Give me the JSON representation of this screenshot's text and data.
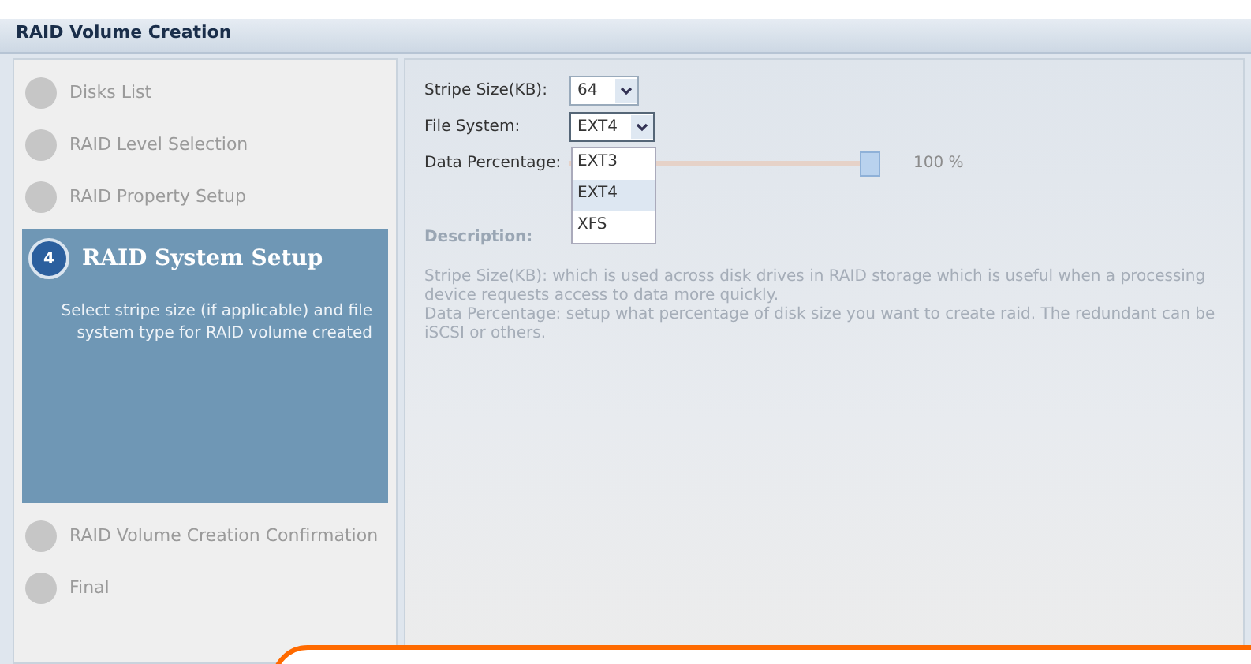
{
  "window": {
    "title": "RAID Volume Creation"
  },
  "steps": [
    {
      "label": "Disks List",
      "selected": false
    },
    {
      "label": "RAID Level Selection",
      "selected": false
    },
    {
      "label": "RAID Property Setup",
      "selected": false
    },
    {
      "label": "RAID System Setup",
      "selected": true,
      "number": "4",
      "description": "Select stripe size (if applicable) and file system type for RAID volume created"
    },
    {
      "label": "RAID Volume Creation Confirmation",
      "selected": false
    },
    {
      "label": "Final",
      "selected": false
    }
  ],
  "form": {
    "stripe_size": {
      "label": "Stripe Size(KB):",
      "value": "64"
    },
    "file_system": {
      "label": "File System:",
      "value": "EXT4",
      "expanded": true,
      "options": [
        {
          "label": "EXT3",
          "selected": false
        },
        {
          "label": "EXT4",
          "selected": true
        },
        {
          "label": "XFS",
          "selected": false
        }
      ]
    },
    "data_percentage": {
      "label": "Data Percentage:",
      "level": 1.0,
      "reading": "100 %"
    }
  },
  "description": {
    "heading": "Description:",
    "paragraphs": [
      "Stripe Size(KB): which is used across disk drives in RAID storage which is useful when a processing device requests access to data more quickly.",
      "Data Percentage: setup what percentage of disk size you want to create raid. The redundant can be iSCSI or others."
    ]
  }
}
